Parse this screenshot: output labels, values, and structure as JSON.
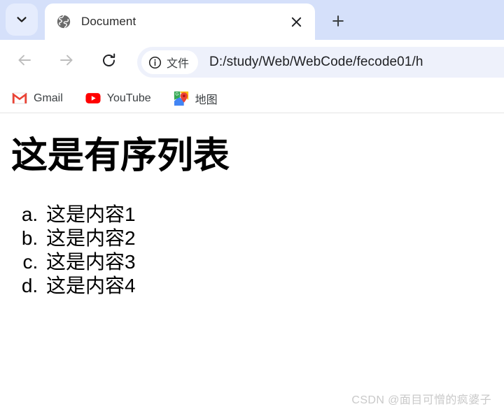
{
  "browser": {
    "tabstrip": {
      "tab_search_icon": "chevron-down-icon",
      "tab": {
        "favicon": "globe-icon",
        "title": "Document",
        "close_icon": "close-icon"
      },
      "new_tab_icon": "plus-icon"
    },
    "toolbar": {
      "back_icon": "arrow-left-icon",
      "forward_icon": "arrow-right-icon",
      "reload_icon": "reload-icon",
      "omnibox": {
        "chip_icon": "info-circle-icon",
        "chip_label": "文件",
        "url": "D:/study/Web/WebCode/fecode01/h"
      }
    },
    "bookmarks": [
      {
        "icon": "gmail-icon",
        "label": "Gmail"
      },
      {
        "icon": "youtube-icon",
        "label": "YouTube"
      },
      {
        "icon": "google-maps-icon",
        "label": "地图"
      }
    ]
  },
  "page": {
    "heading": "这是有序列表",
    "list_type": "lower-alpha",
    "list_items": [
      "这是内容1",
      "这是内容2",
      "这是内容3",
      "这是内容4"
    ],
    "watermark": "CSDN @面目可憎的疯婆子"
  },
  "colors": {
    "tabstrip_bg": "#d5e0fa",
    "omnibox_bg": "#eef1fb",
    "tab_bg": "#ffffff",
    "page_bg": "#ffffff",
    "text": "#000000",
    "watermark": "#c9c9c9"
  }
}
